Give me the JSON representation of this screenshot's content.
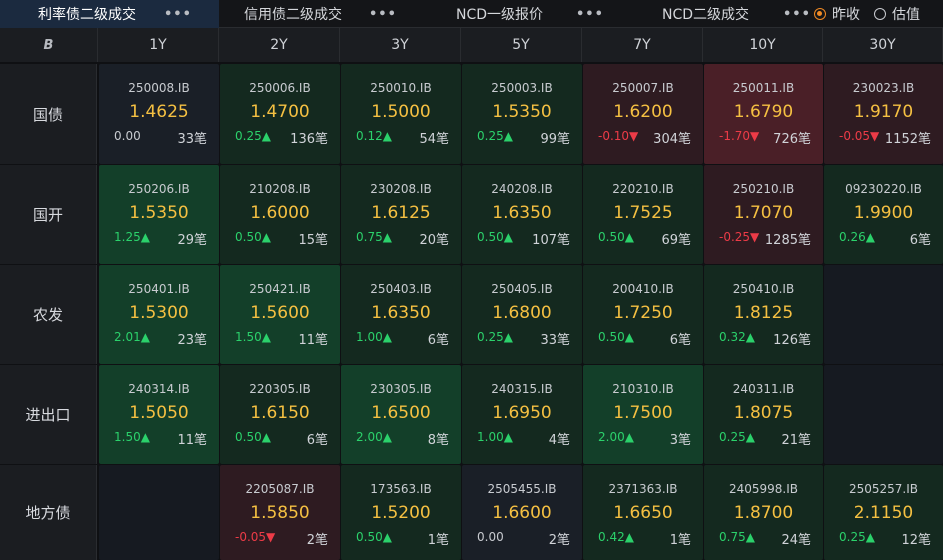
{
  "tabs": [
    {
      "label": "利率债二级成交",
      "active": true
    },
    {
      "label": "信用债二级成交",
      "active": false
    },
    {
      "label": "NCD一级报价",
      "active": false
    },
    {
      "label": "NCD二级成交",
      "active": false
    }
  ],
  "tab_more_symbol": "•••",
  "radio_options": [
    {
      "label": "昨收",
      "checked": true
    },
    {
      "label": "估值",
      "checked": false
    }
  ],
  "corner_icon": "B",
  "columns": [
    "1Y",
    "2Y",
    "3Y",
    "5Y",
    "7Y",
    "10Y",
    "30Y"
  ],
  "colors": {
    "up": "#2bd16b",
    "down": "#ec3b47",
    "yield": "#f5c042",
    "accent": "#f08a24"
  },
  "rows": [
    {
      "label": "国债",
      "cells": [
        {
          "code": "250008.IB",
          "yield": "1.4625",
          "change": "0.00",
          "dir": "flat",
          "count": "33笔",
          "tone": "neutral"
        },
        {
          "code": "250006.IB",
          "yield": "1.4700",
          "change": "0.25▲",
          "dir": "up",
          "count": "136笔",
          "tone": "green1"
        },
        {
          "code": "250010.IB",
          "yield": "1.5000",
          "change": "0.12▲",
          "dir": "up",
          "count": "54笔",
          "tone": "green1"
        },
        {
          "code": "250003.IB",
          "yield": "1.5350",
          "change": "0.25▲",
          "dir": "up",
          "count": "99笔",
          "tone": "green1"
        },
        {
          "code": "250007.IB",
          "yield": "1.6200",
          "change": "-0.10▼",
          "dir": "down",
          "count": "304笔",
          "tone": "red1"
        },
        {
          "code": "250011.IB",
          "yield": "1.6790",
          "change": "-1.70▼",
          "dir": "down",
          "count": "726笔",
          "tone": "red3"
        },
        {
          "code": "230023.IB",
          "yield": "1.9170",
          "change": "-0.05▼",
          "dir": "down",
          "count": "1152笔",
          "tone": "red1"
        }
      ]
    },
    {
      "label": "国开",
      "cells": [
        {
          "code": "250206.IB",
          "yield": "1.5350",
          "change": "1.25▲",
          "dir": "up",
          "count": "29笔",
          "tone": "green2"
        },
        {
          "code": "210208.IB",
          "yield": "1.6000",
          "change": "0.50▲",
          "dir": "up",
          "count": "15笔",
          "tone": "green1"
        },
        {
          "code": "230208.IB",
          "yield": "1.6125",
          "change": "0.75▲",
          "dir": "up",
          "count": "20笔",
          "tone": "green1"
        },
        {
          "code": "240208.IB",
          "yield": "1.6350",
          "change": "0.50▲",
          "dir": "up",
          "count": "107笔",
          "tone": "green1"
        },
        {
          "code": "220210.IB",
          "yield": "1.7525",
          "change": "0.50▲",
          "dir": "up",
          "count": "69笔",
          "tone": "green1"
        },
        {
          "code": "250210.IB",
          "yield": "1.7070",
          "change": "-0.25▼",
          "dir": "down",
          "count": "1285笔",
          "tone": "red1"
        },
        {
          "code": "09230220.IB",
          "yield": "1.9900",
          "change": "0.26▲",
          "dir": "up",
          "count": "6笔",
          "tone": "green1"
        }
      ]
    },
    {
      "label": "农发",
      "cells": [
        {
          "code": "250401.IB",
          "yield": "1.5300",
          "change": "2.01▲",
          "dir": "up",
          "count": "23笔",
          "tone": "green2"
        },
        {
          "code": "250421.IB",
          "yield": "1.5600",
          "change": "1.50▲",
          "dir": "up",
          "count": "11笔",
          "tone": "green2"
        },
        {
          "code": "250403.IB",
          "yield": "1.6350",
          "change": "1.00▲",
          "dir": "up",
          "count": "6笔",
          "tone": "green1"
        },
        {
          "code": "250405.IB",
          "yield": "1.6800",
          "change": "0.25▲",
          "dir": "up",
          "count": "33笔",
          "tone": "green1"
        },
        {
          "code": "200410.IB",
          "yield": "1.7250",
          "change": "0.50▲",
          "dir": "up",
          "count": "6笔",
          "tone": "green1"
        },
        {
          "code": "250410.IB",
          "yield": "1.8125",
          "change": "0.32▲",
          "dir": "up",
          "count": "126笔",
          "tone": "green1"
        },
        null
      ]
    },
    {
      "label": "进出口",
      "cells": [
        {
          "code": "240314.IB",
          "yield": "1.5050",
          "change": "1.50▲",
          "dir": "up",
          "count": "11笔",
          "tone": "green2"
        },
        {
          "code": "220305.IB",
          "yield": "1.6150",
          "change": "0.50▲",
          "dir": "up",
          "count": "6笔",
          "tone": "green1"
        },
        {
          "code": "230305.IB",
          "yield": "1.6500",
          "change": "2.00▲",
          "dir": "up",
          "count": "8笔",
          "tone": "green2"
        },
        {
          "code": "240315.IB",
          "yield": "1.6950",
          "change": "1.00▲",
          "dir": "up",
          "count": "4笔",
          "tone": "green1"
        },
        {
          "code": "210310.IB",
          "yield": "1.7500",
          "change": "2.00▲",
          "dir": "up",
          "count": "3笔",
          "tone": "green2"
        },
        {
          "code": "240311.IB",
          "yield": "1.8075",
          "change": "0.25▲",
          "dir": "up",
          "count": "21笔",
          "tone": "green1"
        },
        null
      ]
    },
    {
      "label": "地方债",
      "cells": [
        null,
        {
          "code": "2205087.IB",
          "yield": "1.5850",
          "change": "-0.05▼",
          "dir": "down",
          "count": "2笔",
          "tone": "red1"
        },
        {
          "code": "173563.IB",
          "yield": "1.5200",
          "change": "0.50▲",
          "dir": "up",
          "count": "1笔",
          "tone": "green1"
        },
        {
          "code": "2505455.IB",
          "yield": "1.6600",
          "change": "0.00",
          "dir": "flat",
          "count": "2笔",
          "tone": "neutral"
        },
        {
          "code": "2371363.IB",
          "yield": "1.6650",
          "change": "0.42▲",
          "dir": "up",
          "count": "1笔",
          "tone": "green1"
        },
        {
          "code": "2405998.IB",
          "yield": "1.8700",
          "change": "0.75▲",
          "dir": "up",
          "count": "24笔",
          "tone": "green1"
        },
        {
          "code": "2505257.IB",
          "yield": "2.1150",
          "change": "0.25▲",
          "dir": "up",
          "count": "12笔",
          "tone": "green1"
        }
      ]
    }
  ]
}
